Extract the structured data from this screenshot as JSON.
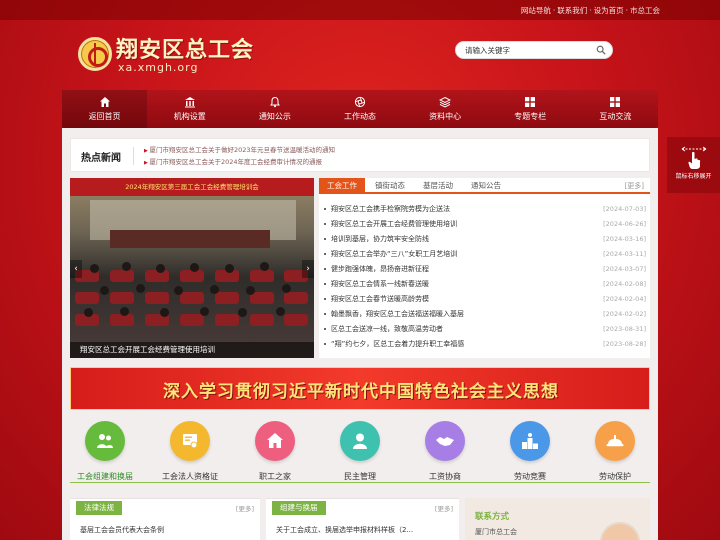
{
  "topbar": {
    "links": [
      "网站导航",
      "联系我们",
      "设为首页",
      "市总工会"
    ]
  },
  "header": {
    "title": "翔安区总工会",
    "domain": "xa.xmgh.org",
    "search_placeholder": "请输入关键字"
  },
  "nav": {
    "items": [
      {
        "label": "返回首页",
        "icon": "home-icon"
      },
      {
        "label": "机构设置",
        "icon": "building-icon"
      },
      {
        "label": "通知公示",
        "icon": "bell-icon"
      },
      {
        "label": "工作动态",
        "icon": "aperture-icon"
      },
      {
        "label": "资料中心",
        "icon": "layers-icon"
      },
      {
        "label": "专题专栏",
        "icon": "grid-icon"
      },
      {
        "label": "互动交流",
        "icon": "grid-icon"
      }
    ]
  },
  "hot_news": {
    "label": "热点新闻",
    "lines": [
      "厦门市翔安区总工会关于做好2023年元旦春节送温暖活动的通知",
      "厦门市翔安区总工会关于2024年度工会经费审计情况的通报"
    ]
  },
  "photo": {
    "banner_text": "2024年翔安区第三届工会工会经费管理培训会",
    "caption": "翔安区总工会开展工会经费管理使用培训"
  },
  "news_tabs": {
    "tabs": [
      "工会工作",
      "镇街动态",
      "基层活动",
      "通知公告"
    ],
    "more": "[更多]",
    "items": [
      {
        "title": "翔安区总工会携手检察院劳模为企送法",
        "date": "[2024-07-03]"
      },
      {
        "title": "翔安区总工会开展工会经费管理使用培训",
        "date": "[2024-06-26]"
      },
      {
        "title": "培训到基层，协力筑牢安全防线",
        "date": "[2024-03-16]"
      },
      {
        "title": "翔安区总工会举办“三八”女职工月艺培训",
        "date": "[2024-03-11]"
      },
      {
        "title": "健步跑强体魄，昂扬奋进新征程",
        "date": "[2024-03-07]"
      },
      {
        "title": "翔安区总工会情系一线新春送暖",
        "date": "[2024-02-08]"
      },
      {
        "title": "翔安区总工会春节送暖高龄劳模",
        "date": "[2024-02-04]"
      },
      {
        "title": "翰墨飘香，翔安区总工会送福送福暖入基层",
        "date": "[2024-02-02]"
      },
      {
        "title": "区总工会送凉一线，致敬高温劳动者",
        "date": "[2023-08-31]"
      },
      {
        "title": "“翔”约七夕，区总工会着力提升职工幸福感",
        "date": "[2023-08-28]"
      }
    ]
  },
  "slogan": "深入学习贯彻习近平新时代中国特色社会主义思想",
  "services": [
    {
      "label": "工会组建和换届",
      "color": "#66bb3c",
      "icon": "people-icon"
    },
    {
      "label": "工会法人资格证",
      "color": "#f3b82e",
      "icon": "certificate-icon"
    },
    {
      "label": "职工之家",
      "color": "#ee5e7e",
      "icon": "house-icon"
    },
    {
      "label": "民主管理",
      "color": "#3fc1b0",
      "icon": "user-icon"
    },
    {
      "label": "工资协商",
      "color": "#a77ee5",
      "icon": "handshake-icon"
    },
    {
      "label": "劳动竞赛",
      "color": "#4b97e8",
      "icon": "podium-icon"
    },
    {
      "label": "劳动保护",
      "color": "#f6a04a",
      "icon": "helmet-icon"
    }
  ],
  "bottom": {
    "law": {
      "title": "法律法规",
      "more": "[更多]",
      "item": "基层工会会员代表大会条例"
    },
    "org": {
      "title": "组建与换届",
      "more": "[更多]",
      "item": "关于工会成立、换届选举申报材料样板（2..."
    },
    "contact": {
      "title": "联系方式",
      "line": "厦门市总工会"
    }
  },
  "float_tip": {
    "label": "鼠标右移展开"
  },
  "colors": {
    "primary_red": "#c8141a",
    "accent_orange": "#e2541a",
    "accent_green": "#7cb342"
  }
}
